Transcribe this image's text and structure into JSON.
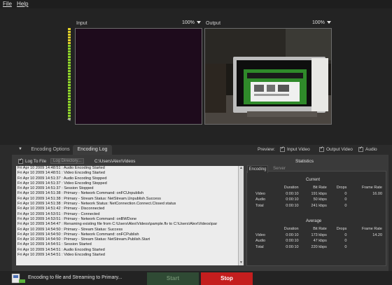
{
  "menu": {
    "file": "File",
    "help": "Help"
  },
  "input_panel": {
    "title": "Input",
    "zoom": "100%"
  },
  "output_panel": {
    "title": "Output",
    "zoom": "100%"
  },
  "tabs": {
    "encoding_options": "Encoding Options",
    "encoding_log": "Encoding Log"
  },
  "preview": {
    "label": "Preview:",
    "input_video": "Input Video",
    "output_video": "Output Video",
    "audio": "Audio"
  },
  "log_controls": {
    "log_to_file": "Log To File",
    "log_directory": "Log Directory...",
    "path": "C:\\Users\\Alex\\Videos"
  },
  "log_lines": [
    "Fri Apr 10 2009 14:48:51 : Audio Encoding Started",
    "Fri Apr 10 2009 14:48:51 : Video Encoding Started",
    "Fri Apr 10 2009 14:51:37 : Audio Encoding Stopped",
    "Fri Apr 10 2009 14:51:37 : Video Encoding Stopped",
    "Fri Apr 10 2009 14:51:37 : Session Stopped",
    "Fri Apr 10 2009 14:51:38 : Primary - Network Command: onFCUnpublish",
    "Fri Apr 10 2009 14:51:38 : Primary - Stream Status: NetStream.Unpublish.Success",
    "Fri Apr 10 2009 14:51:38 : Primary - Network Status: NetConnection.Connect.Closed status",
    "Fri Apr 10 2009 14:51:42 : Primary - Disconnected",
    "Fri Apr 10 2009 14:53:51 : Primary - Connected",
    "Fri Apr 10 2009 14:53:51 : Primary - Network Command: onBWDone",
    "Fri Apr 10 2009 14:54:47 : Renaming existing file from C:\\Users\\Alex\\Videos\\pample.flv to C:\\Users\\Alex\\Videos\\par",
    "Fri Apr 10 2009 14:54:50 : Primary - Stream Status: Success",
    "Fri Apr 10 2009 14:54:50 : Primary - Network Command: onFCPublish",
    "Fri Apr 10 2009 14:54:50 : Primary - Stream Status: NetStream.Publish.Start",
    "Fri Apr 10 2009 14:54:51 : Session Started",
    "Fri Apr 10 2009 14:54:51 : Audio Encoding Started",
    "Fri Apr 10 2009 14:54:51 : Video Encoding Started"
  ],
  "statistics": {
    "title": "Statistics",
    "tabs": [
      "Encoding",
      "Server"
    ],
    "columns": [
      "Duration",
      "Bit Rate",
      "Drops",
      "Frame Rate"
    ],
    "current_label": "Current",
    "current": [
      {
        "label": "Video",
        "duration": "0:00:10",
        "bitrate": "191 kbps",
        "drops": "0",
        "framerate": "16.00"
      },
      {
        "label": "Audio",
        "duration": "0:00:10",
        "bitrate": "50 kbps",
        "drops": "0",
        "framerate": ""
      },
      {
        "label": "Total",
        "duration": "0:00:10",
        "bitrate": "241 kbps",
        "drops": "0",
        "framerate": ""
      }
    ],
    "average_label": "Average",
    "average": [
      {
        "label": "Video",
        "duration": "0:00:10",
        "bitrate": "173 kbps",
        "drops": "0",
        "framerate": "14.20"
      },
      {
        "label": "Audio",
        "duration": "0:00:10",
        "bitrate": "47 kbps",
        "drops": "0",
        "framerate": ""
      },
      {
        "label": "Total",
        "duration": "0:00:10",
        "bitrate": "220 kbps",
        "drops": "0",
        "framerate": ""
      }
    ]
  },
  "status": {
    "text": "Encoding to file and Streaming to Primary...",
    "start": "Start",
    "stop": "Stop"
  },
  "colors": {
    "stop": "#c41e1e",
    "start": "#2f4a34",
    "vu_green": "#8fd42c",
    "vu_yellow": "#e0d02a"
  }
}
